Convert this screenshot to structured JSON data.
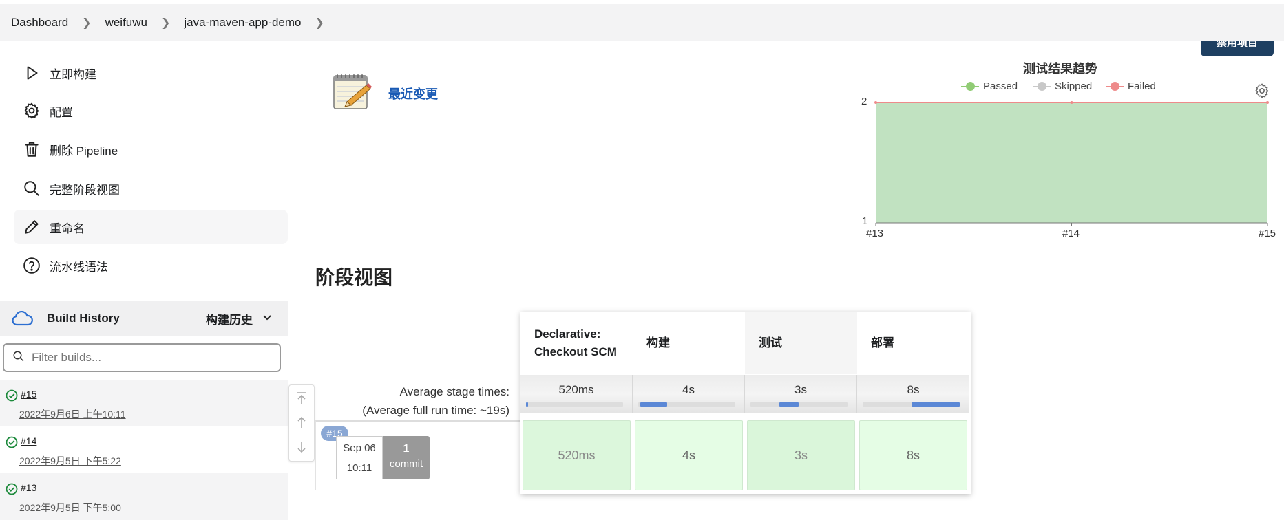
{
  "breadcrumb": [
    "Dashboard",
    "weifuwu",
    "java-maven-app-demo"
  ],
  "tasks": [
    {
      "label": "立即构建",
      "icon": "play-icon"
    },
    {
      "label": "配置",
      "icon": "gear-icon"
    },
    {
      "label": "删除 Pipeline",
      "icon": "trash-icon"
    },
    {
      "label": "完整阶段视图",
      "icon": "search-icon"
    },
    {
      "label": "重命名",
      "icon": "pencil-icon"
    },
    {
      "label": "流水线语法",
      "icon": "help-icon"
    }
  ],
  "build_history": {
    "title": "Build History",
    "trend_link": "构建历史",
    "filter_placeholder": "Filter builds...",
    "builds": [
      {
        "number": "#15",
        "date": "2022年9月6日 上午10:11",
        "status": "success"
      },
      {
        "number": "#14",
        "date": "2022年9月5日 下午5:22",
        "status": "success"
      },
      {
        "number": "#13",
        "date": "2022年9月5日 下午5:00",
        "status": "success"
      }
    ]
  },
  "header_button": "禁用项目",
  "recent_changes": "最近变更",
  "chart_data": {
    "type": "area",
    "title": "测试结果趋势",
    "legend": [
      "Passed",
      "Skipped",
      "Failed"
    ],
    "colors": {
      "Passed": "#91cc75",
      "Skipped": "#c8c8c8",
      "Failed": "#ee8b8b",
      "area": "#c1e2c1"
    },
    "categories": [
      "#13",
      "#14",
      "#15"
    ],
    "series": [
      {
        "name": "Passed",
        "values": [
          2,
          2,
          2
        ]
      },
      {
        "name": "Skipped",
        "values": [
          0,
          0,
          0
        ]
      },
      {
        "name": "Failed",
        "values": [
          0,
          0,
          0
        ]
      }
    ],
    "yticks": [
      "1",
      "2"
    ],
    "ylim": [
      1,
      2
    ]
  },
  "stage_view": {
    "title": "阶段视图",
    "avg_label_line1": "Average stage times:",
    "avg_label_pre": "(Average ",
    "avg_label_link": "full",
    "avg_label_post": " run time: ~19s)",
    "stages": [
      {
        "name": "Declarative: Checkout SCM",
        "avg": "520ms",
        "run": "520ms",
        "progress": [
          0,
          0.02
        ]
      },
      {
        "name": "构建",
        "avg": "4s",
        "run": "4s",
        "progress": [
          0.02,
          0.3
        ]
      },
      {
        "name": "测试",
        "avg": "3s",
        "run": "3s",
        "progress": [
          0.3,
          0.5
        ]
      },
      {
        "name": "部署",
        "avg": "8s",
        "run": "8s",
        "progress": [
          0.5,
          1.0
        ]
      }
    ],
    "run": {
      "badge": "#15",
      "date": "Sep 06",
      "time": "10:11",
      "commits": "1",
      "commit_label": "commit"
    }
  }
}
